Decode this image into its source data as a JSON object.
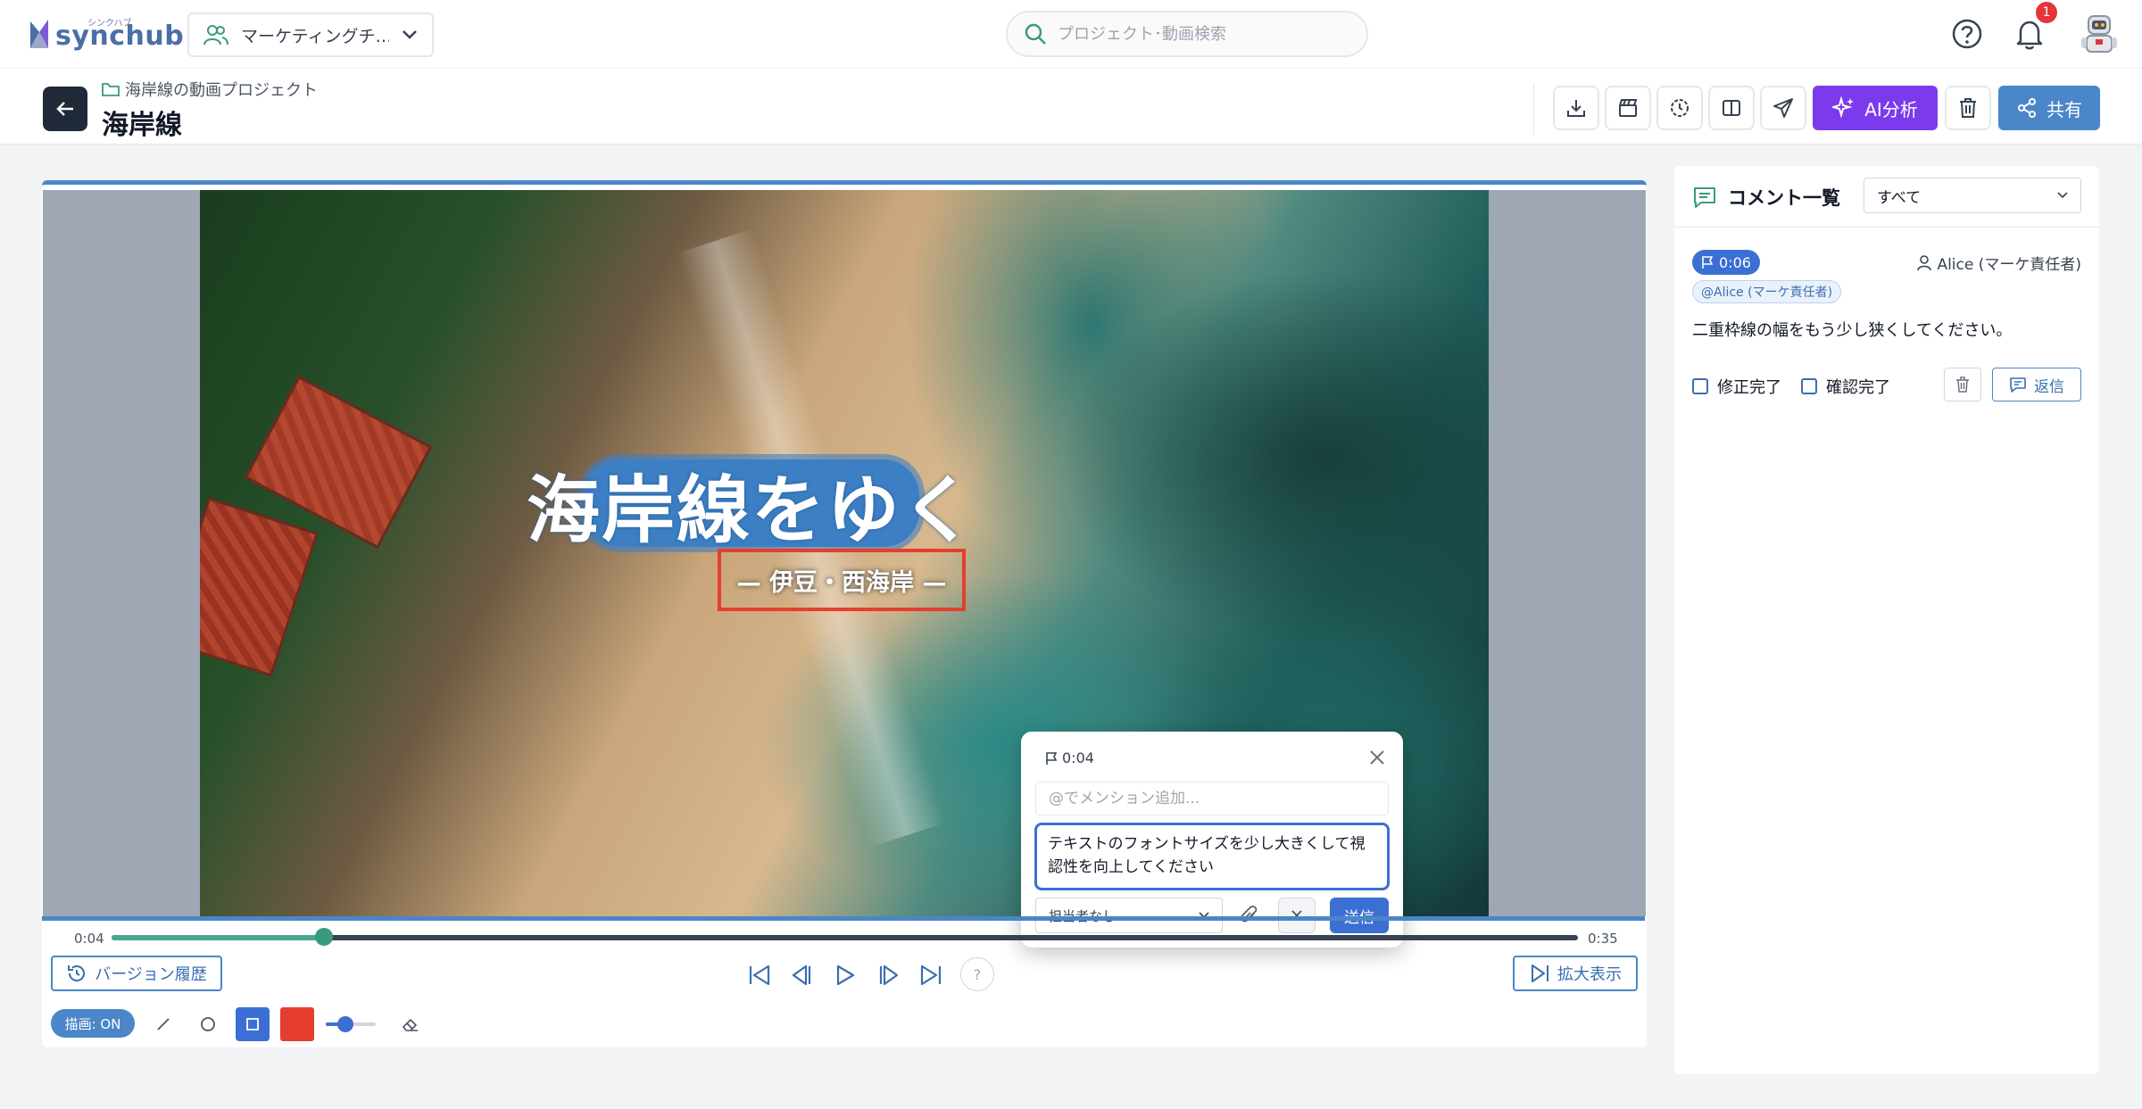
{
  "app": {
    "logo_text": "synchub",
    "logo_ruby": "シンクハブ",
    "team_selector": "マーケティングチ…",
    "search_placeholder": "プロジェクト･動画検索",
    "notifications_count": "1"
  },
  "project": {
    "breadcrumb": "海岸線の動画プロジェクト",
    "title": "海岸線",
    "ai_button": "AI分析",
    "share_button": "共有"
  },
  "video": {
    "title_overlay": "海岸線をゆく",
    "subtitle_overlay": "— 伊豆・西海岸 —",
    "current_time": "0:04",
    "duration": "0:35",
    "progress": 0.145
  },
  "popup": {
    "timestamp": "0:04",
    "mention_placeholder": "@でメンション追加...",
    "comment_text": "テキストのフォントサイズを少し大きくして視認性を向上してください",
    "assignee": "担当者なし",
    "send_label": "送信"
  },
  "controls": {
    "version_history": "バージョン履歴",
    "expand": "拡大表示",
    "help": "?",
    "draw_toggle": "描画: ON",
    "draw_color": "#e53e2e",
    "stroke_size": 0.4
  },
  "comments": {
    "title": "コメント一覧",
    "filter": "すべて",
    "items": [
      {
        "time": "0:06",
        "author": "Alice (マーケ責任者)",
        "mention": "@Alice (マーケ責任者)",
        "body": "二重枠線の幅をもう少し狭くしてください。",
        "fix_done": "修正完了",
        "confirm_done": "確認完了",
        "reply": "返信"
      }
    ]
  },
  "colors": {
    "primary": "#4a86c8",
    "accent_purple": "#7c3aed",
    "send_blue": "#3b6fd4",
    "alert_red": "#e5343b"
  }
}
